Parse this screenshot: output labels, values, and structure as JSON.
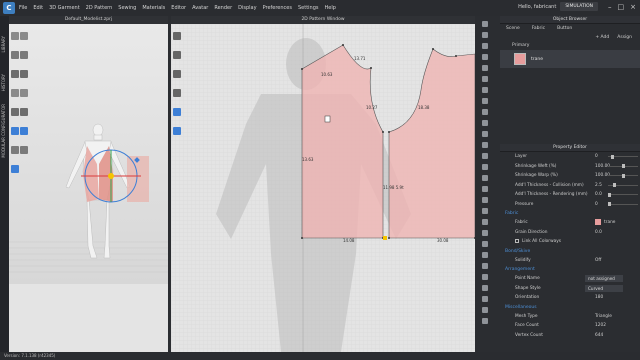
{
  "menu": [
    "File",
    "Edit",
    "3D Garment",
    "2D Pattern",
    "Sewing",
    "Materials",
    "Editor",
    "Avatar",
    "Render",
    "Display",
    "Preferences",
    "Settings",
    "Help"
  ],
  "user": "Hello, fabricant",
  "simulation_label": "SIMULATION",
  "vertical_tabs": [
    "LIBRARY",
    "HISTORY",
    "MODULAR CONFIGURATOR"
  ],
  "window_3d_title": "Default_Modelist.zprj",
  "window_2d_title": "2D Pattern Window",
  "pattern_labels": [
    "13.71",
    "10.63",
    "10.27",
    "18.38",
    "13.63",
    "11.98 5.9t",
    "14.08",
    "30.08"
  ],
  "object_browser": {
    "title": "Object Browser",
    "tabs": [
      "Scene",
      "Fabric",
      "Button"
    ],
    "actions": [
      "+ Add",
      "Assign"
    ],
    "group": "Primary",
    "item_name": "trane",
    "item_color": "#e79d9d"
  },
  "property_editor": {
    "title": "Property Editor",
    "rows": [
      {
        "label": "Layer",
        "value": "0",
        "slider": 0.1
      },
      {
        "label": "Shrinkage Weft (%)",
        "value": "100.00",
        "slider": 0.5
      },
      {
        "label": "Shrinkage Warp (%)",
        "value": "100.00",
        "slider": 0.5
      },
      {
        "label": "Add'l Thickness - Collision (mm)",
        "value": "2.5",
        "slider": 0.2
      },
      {
        "label": "Add'l Thickness - Rendering (mm)",
        "value": "0.0",
        "slider": 0.0
      },
      {
        "label": "Pressure",
        "value": "0",
        "slider": 0.0
      }
    ],
    "fabric_section": "Fabric",
    "fabric_label": "Fabric",
    "fabric_value": "trane",
    "grain_label": "Grain Direction",
    "grain_value": "0.0",
    "link_colorways": "Link All Colorways",
    "bond_section": "Bond/Skive",
    "solidify_label": "Solidify",
    "solidify_value": "Off",
    "arrangement_section": "Arrangement",
    "point_name_label": "Point Name",
    "point_name_value": "not assigned",
    "shape_style_label": "Shape Style",
    "shape_style_value": "Curved",
    "orientation_label": "Orientation",
    "orientation_value": "180",
    "misc_section": "Miscellaneous",
    "mesh_type_label": "Mesh Type",
    "mesh_type_value": "Triangle",
    "face_count_label": "Face Count",
    "face_count_value": "1202",
    "vertex_count_label": "Vertex Count",
    "vertex_count_value": "644"
  },
  "status": "Version: 7.1.138 (r42345)"
}
